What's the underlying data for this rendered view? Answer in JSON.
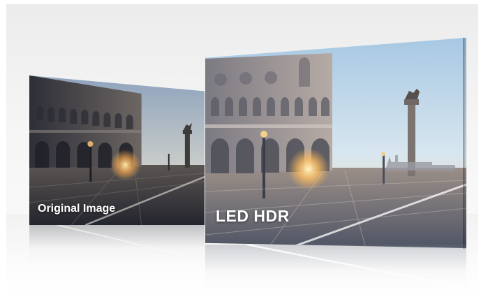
{
  "panels": {
    "left": {
      "label": "Original Image"
    },
    "right": {
      "label": "LED HDR"
    }
  },
  "colors": {
    "stage_background": "#f2f2f2",
    "sky_original_top": "#8fa6c0",
    "sky_hdr_top": "#a9cbe6",
    "sunset_glow": "#ffd27a",
    "pavement_original": "#3a3d47",
    "pavement_hdr": "#6a6f7e"
  }
}
